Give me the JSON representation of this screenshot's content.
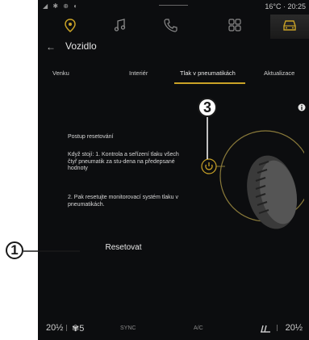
{
  "status_bar": {
    "left_icons": "◢ ✱ ⊕ ◐",
    "temp_time": "16°C · 20:25"
  },
  "top_nav": {
    "icons": [
      "location-icon",
      "music-icon",
      "phone-icon",
      "apps-grid-icon",
      "car-icon"
    ],
    "active": "car-icon"
  },
  "header": {
    "back": "←",
    "title": "Vozidlo"
  },
  "tabs": [
    {
      "label": "Venku"
    },
    {
      "label": "Interiér"
    },
    {
      "label": "Tlak v pneumatikách",
      "active": true
    },
    {
      "label": "Aktualizace"
    }
  ],
  "instructions": {
    "heading": "Postup resetování",
    "step1": "Když stojí: 1. Kontrola a seřízení tlaku všech čtyř pneumatik za stu-dena na předepsané hodnoty",
    "step2": "2. Pak resetujte monitorovací systém tlaku v pneumatikách."
  },
  "reset_button": {
    "label": "Resetovat"
  },
  "callouts": {
    "one": "1",
    "three": "3"
  },
  "bottom_bar": {
    "temp_left": "20½",
    "fan_left": "5",
    "sync": "SYNC",
    "ac": "A/C",
    "temp_right": "20½"
  },
  "colors": {
    "accent": "#c9a227",
    "background": "#0c0d0f"
  }
}
